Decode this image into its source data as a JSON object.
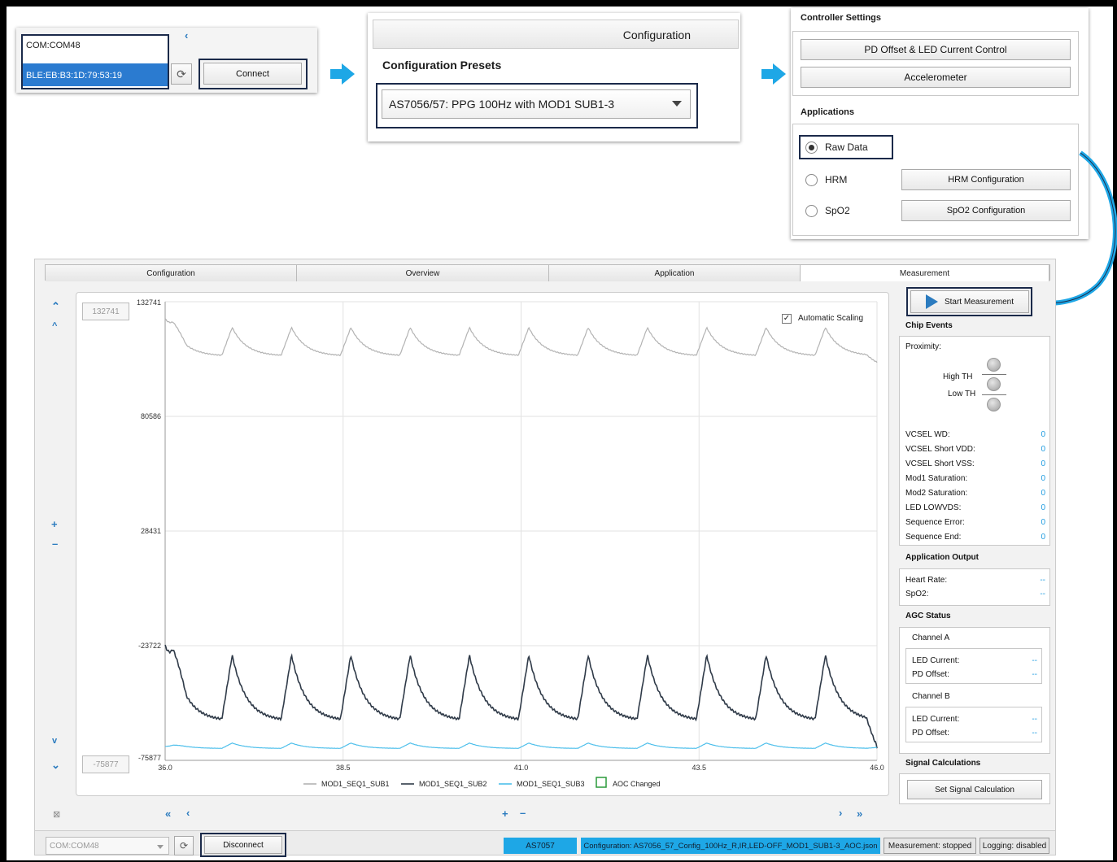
{
  "connect_panel": {
    "port_options": [
      "COM:COM48",
      "BLE:EB:B3:1D:79:53:19"
    ],
    "selected_index": 1,
    "connect_label": "Connect"
  },
  "config_panel": {
    "tab_label": "Configuration",
    "presets_heading": "Configuration Presets",
    "preset_value": "AS7056/57: PPG 100Hz with MOD1 SUB1-3"
  },
  "controller": {
    "heading": "Controller Settings",
    "pd_button": "PD Offset & LED Current Control",
    "accel_button": "Accelerometer",
    "apps_heading": "Applications",
    "raw_label": "Raw Data",
    "hrm_label": "HRM",
    "hrm_config": "HRM Configuration",
    "spo2_label": "SpO2",
    "spo2_config": "SpO2 Configuration"
  },
  "tabs": [
    "Configuration",
    "Overview",
    "Application",
    "Measurement"
  ],
  "plot": {
    "ymax_box": "132741",
    "ymin_box": "-75877",
    "auto_scaling": "Automatic Scaling",
    "auto_checked": "✓",
    "legend": [
      "MOD1_SEQ1_SUB1",
      "MOD1_SEQ1_SUB2",
      "MOD1_SEQ1_SUB3"
    ],
    "aoc_label": "AOC Changed"
  },
  "chart_data": {
    "type": "line",
    "xlim": [
      36.0,
      46.0
    ],
    "ylim": [
      -75877,
      132741
    ],
    "yticks": [
      "132741",
      "80586",
      "28431",
      "-23722",
      "-75877"
    ],
    "xticks": [
      "36.0",
      "38.5",
      "41.0",
      "43.5",
      "46.0"
    ],
    "series": [
      {
        "name": "MOD1_SEQ1_SUB1",
        "color": "#b3b3b3",
        "base": 108000,
        "peak": 121000,
        "start": 125000,
        "end": 105000
      },
      {
        "name": "MOD1_SEQ1_SUB2",
        "color": "#2f3a48",
        "base": -58000,
        "peak": -28000,
        "start": -23722,
        "end": -70000
      },
      {
        "name": "MOD1_SEQ1_SUB3",
        "color": "#4dbfeb",
        "base": -70500,
        "peak": -68000,
        "start": -69500,
        "end": -70000
      }
    ],
    "cycles": 12
  },
  "side": {
    "start_label": "Start Measurement",
    "chip_events": "Chip Events",
    "proximity": "Proximity:",
    "high_th": "High TH",
    "low_th": "Low TH",
    "events": [
      {
        "label": "VCSEL WD:",
        "value": "0"
      },
      {
        "label": "VCSEL Short VDD:",
        "value": "0"
      },
      {
        "label": "VCSEL Short VSS:",
        "value": "0"
      },
      {
        "label": "Mod1 Saturation:",
        "value": "0"
      },
      {
        "label": "Mod2 Saturation:",
        "value": "0"
      },
      {
        "label": "LED LOWVDS:",
        "value": "0"
      },
      {
        "label": "Sequence Error:",
        "value": "0"
      },
      {
        "label": "Sequence End:",
        "value": "0"
      }
    ],
    "app_output": "Application Output",
    "heart_rate": "Heart Rate:",
    "spo2": "SpO2:",
    "dash": "--",
    "agc_status": "AGC Status",
    "channel_a": "Channel A",
    "channel_b": "Channel B",
    "led_current": "LED Current:",
    "pd_offset": "PD Offset:",
    "signal_calc": "Signal Calculations",
    "set_signal": "Set Signal Calculation"
  },
  "status": {
    "port": "COM:COM48",
    "disconnect": "Disconnect",
    "chip": "AS7057",
    "config": "Configuration: AS7056_57_Config_100Hz_R,IR,LED-OFF_MOD1_SUB1-3_AOC.json",
    "measurement": "Measurement: stopped",
    "logging": "Logging: disabled"
  },
  "colors": {
    "accent": "#1ea7e6",
    "highlight": "#1b2a4a",
    "value": "#1f9ce0"
  }
}
